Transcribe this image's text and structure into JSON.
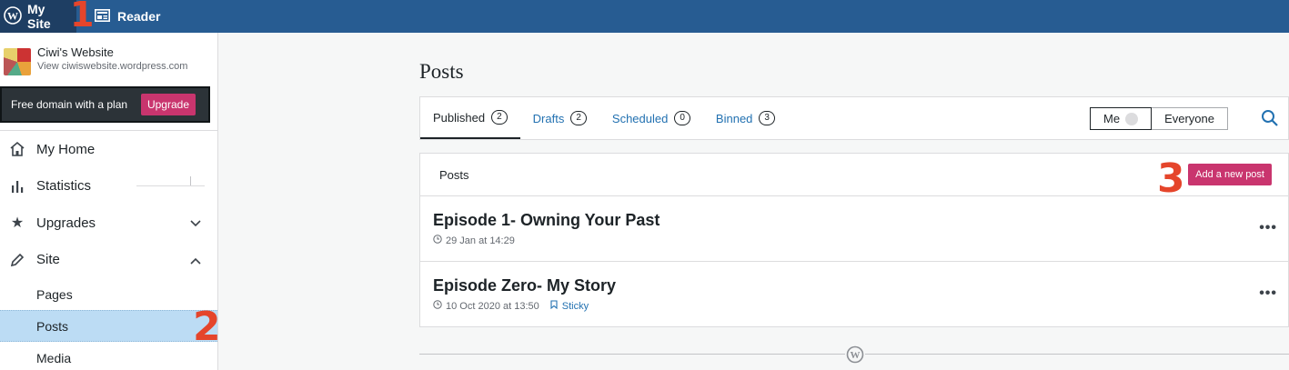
{
  "masterbar": {
    "my_site": "My Site",
    "reader": "Reader"
  },
  "site": {
    "title": "Ciwi's Website",
    "url": "View ciwiswebsite.wordpress.com"
  },
  "promo": {
    "text": "Free domain with a plan",
    "button": "Upgrade"
  },
  "sidebar": {
    "items": [
      {
        "label": "My Home",
        "icon": "home-icon"
      },
      {
        "label": "Statistics",
        "icon": "bar-chart-icon"
      },
      {
        "label": "Upgrades",
        "icon": "star-icon"
      },
      {
        "label": "Site",
        "icon": "pencil-icon"
      }
    ],
    "sub_items": [
      "Pages",
      "Posts",
      "Media"
    ]
  },
  "annotations": [
    "1",
    "2",
    "3"
  ],
  "main": {
    "title": "Posts",
    "tabs": [
      {
        "label": "Published",
        "count": "2"
      },
      {
        "label": "Drafts",
        "count": "2"
      },
      {
        "label": "Scheduled",
        "count": "0"
      },
      {
        "label": "Binned",
        "count": "3"
      }
    ],
    "author_filter": {
      "me": "Me",
      "everyone": "Everyone"
    },
    "list_header": "Posts",
    "add_button": "Add a new post",
    "posts": [
      {
        "title": "Episode 1- Owning Your Past",
        "date": "29 Jan at 14:29",
        "sticky": ""
      },
      {
        "title": "Episode Zero- My Story",
        "date": "10 Oct 2020 at 13:50",
        "sticky": "Sticky"
      }
    ]
  },
  "colors": {
    "masterbar": "#275c92",
    "accent": "#c9356e",
    "link": "#2271b1"
  }
}
